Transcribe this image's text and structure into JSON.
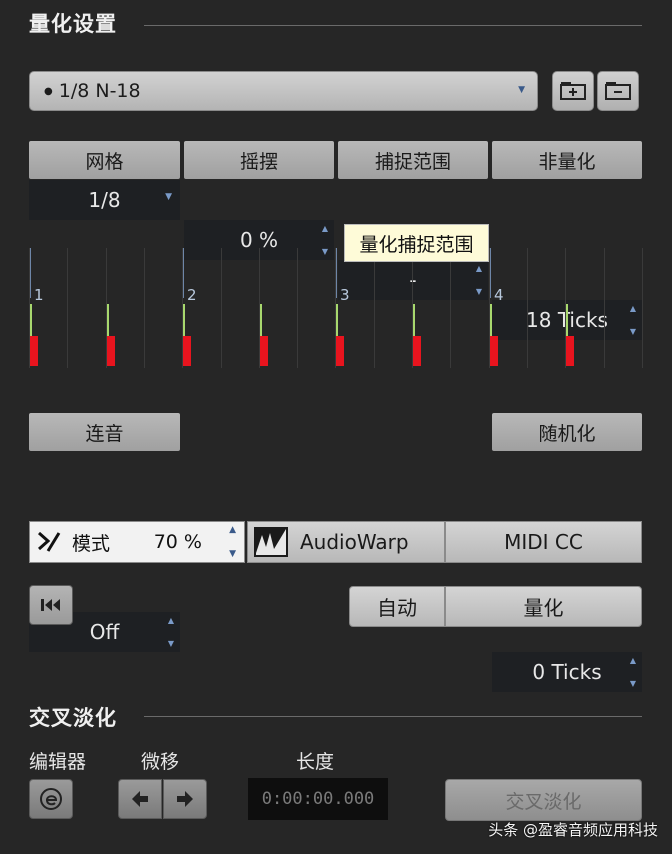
{
  "quantize": {
    "title": "量化设置",
    "preset": "1/8  N-18",
    "columns": [
      {
        "header": "网格",
        "value": "1/8",
        "control": "dropdown"
      },
      {
        "header": "摇摆",
        "value": "0 %",
        "control": "stepper"
      },
      {
        "header": "捕捉范围",
        "value": "-",
        "control": "stepper"
      },
      {
        "header": "非量化",
        "value": "18 Ticks",
        "control": "stepper"
      }
    ],
    "tooltip": "量化捕捉范围",
    "grid_beats": [
      "1",
      "2",
      "3",
      "4"
    ],
    "tuplet": {
      "header": "连音",
      "value": "Off"
    },
    "random": {
      "header": "随机化",
      "value": "0 Ticks"
    },
    "mode": {
      "label": "模式",
      "value": "70 %"
    },
    "audiowarp_label": "AudioWarp",
    "midicc_label": "MIDI CC",
    "auto_label": "自动",
    "quantize_label": "量化"
  },
  "crossfade": {
    "title": "交叉淡化",
    "editor_label": "编辑器",
    "nudge_label": "微移",
    "length_label": "长度",
    "length_value": "0:00:00.000",
    "button_label": "交叉淡化"
  },
  "watermark": "头条 @盈睿音频应用科技",
  "colors": {
    "hit_red": "#e8141e",
    "offset_green": "#a8d86e",
    "beat_blue": "#6e86a8"
  }
}
